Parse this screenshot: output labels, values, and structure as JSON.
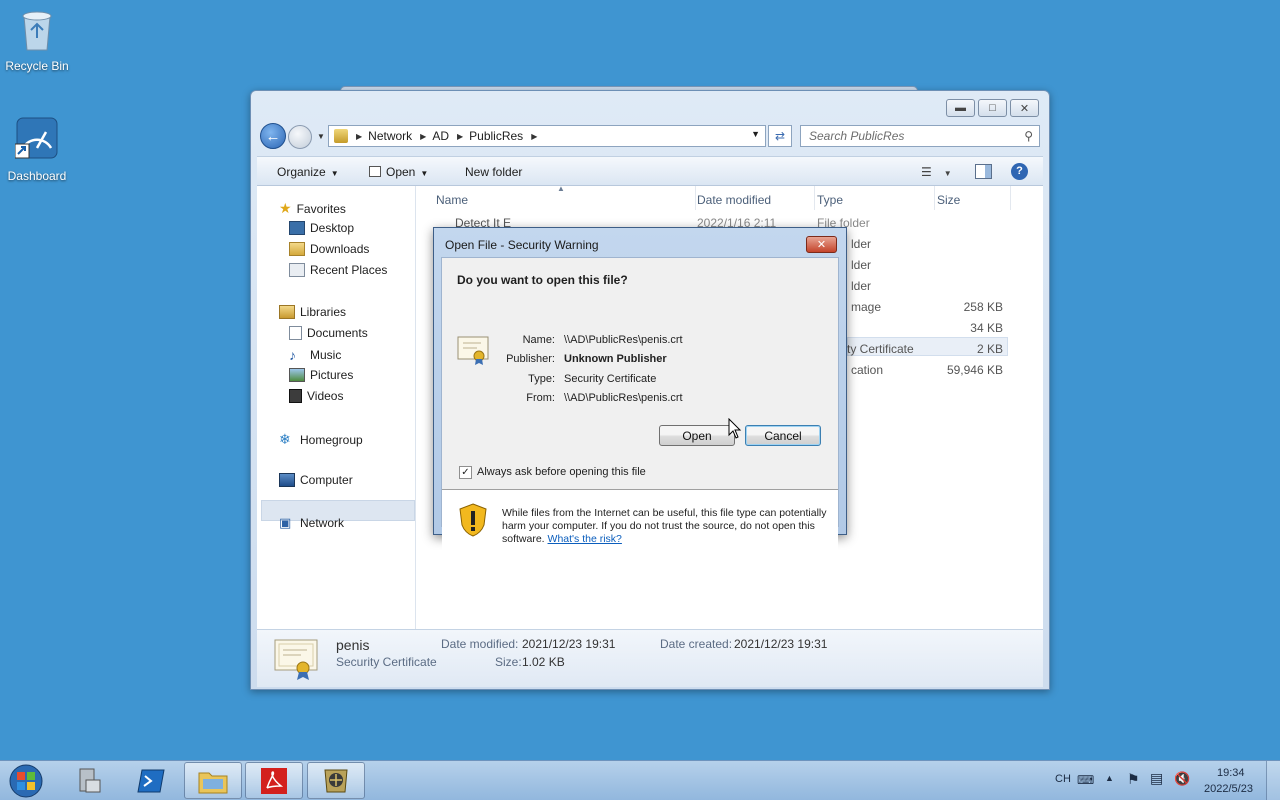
{
  "desktop": {
    "icons": [
      {
        "label": "Recycle Bin",
        "icon": "recycle-bin-icon"
      },
      {
        "label": "Dashboard",
        "icon": "dashboard-icon"
      }
    ]
  },
  "explorer": {
    "breadcrumb": [
      "Network",
      "AD",
      "PublicRes"
    ],
    "search_placeholder": "Search PublicRes",
    "toolbar": {
      "organize": "Organize",
      "open": "Open",
      "new_folder": "New folder"
    },
    "nav": {
      "favorites": "Favorites",
      "desktop": "Desktop",
      "downloads": "Downloads",
      "recent_places": "Recent Places",
      "libraries": "Libraries",
      "documents": "Documents",
      "music": "Music",
      "pictures": "Pictures",
      "videos": "Videos",
      "homegroup": "Homegroup",
      "computer": "Computer",
      "network": "Network"
    },
    "columns": {
      "name": "Name",
      "date_modified": "Date modified",
      "type": "Type",
      "size": "Size"
    },
    "visible_fragments": {
      "type_frag": [
        "lder",
        "lder",
        "lder",
        "mage",
        "ty Certificate",
        "cation"
      ],
      "sizes": [
        "258 KB",
        "34 KB",
        "2 KB",
        "59,946 KB"
      ],
      "partial_name": "Detect It E",
      "partial_date": "2022/1/16 2:11",
      "partial_type": "File folder"
    },
    "details": {
      "file_name": "penis",
      "file_type": "Security Certificate",
      "date_modified_label": "Date modified:",
      "date_modified": "2021/12/23 19:31",
      "size_label": "Size:",
      "size": "1.02 KB",
      "date_created_label": "Date created:",
      "date_created": "2021/12/23 19:31"
    }
  },
  "dialog": {
    "title": "Open File - Security Warning",
    "question": "Do you want to open this file?",
    "fields": {
      "name_label": "Name:",
      "name": "\\\\AD\\PublicRes\\penis.crt",
      "publisher_label": "Publisher:",
      "publisher": "Unknown Publisher",
      "type_label": "Type:",
      "type": "Security Certificate",
      "from_label": "From:",
      "from": "\\\\AD\\PublicRes\\penis.crt"
    },
    "open_button": "Open",
    "cancel_button": "Cancel",
    "checkbox_label": "Always ask before opening this file",
    "checkbox_checked": true,
    "warning_text": "While files from the Internet can be useful, this file type can potentially harm your computer. If you do not trust the source, do not open this software.",
    "risk_link": "What's the risk?"
  },
  "taskbar": {
    "lang": "CH",
    "time": "19:34",
    "date": "2022/5/23"
  }
}
